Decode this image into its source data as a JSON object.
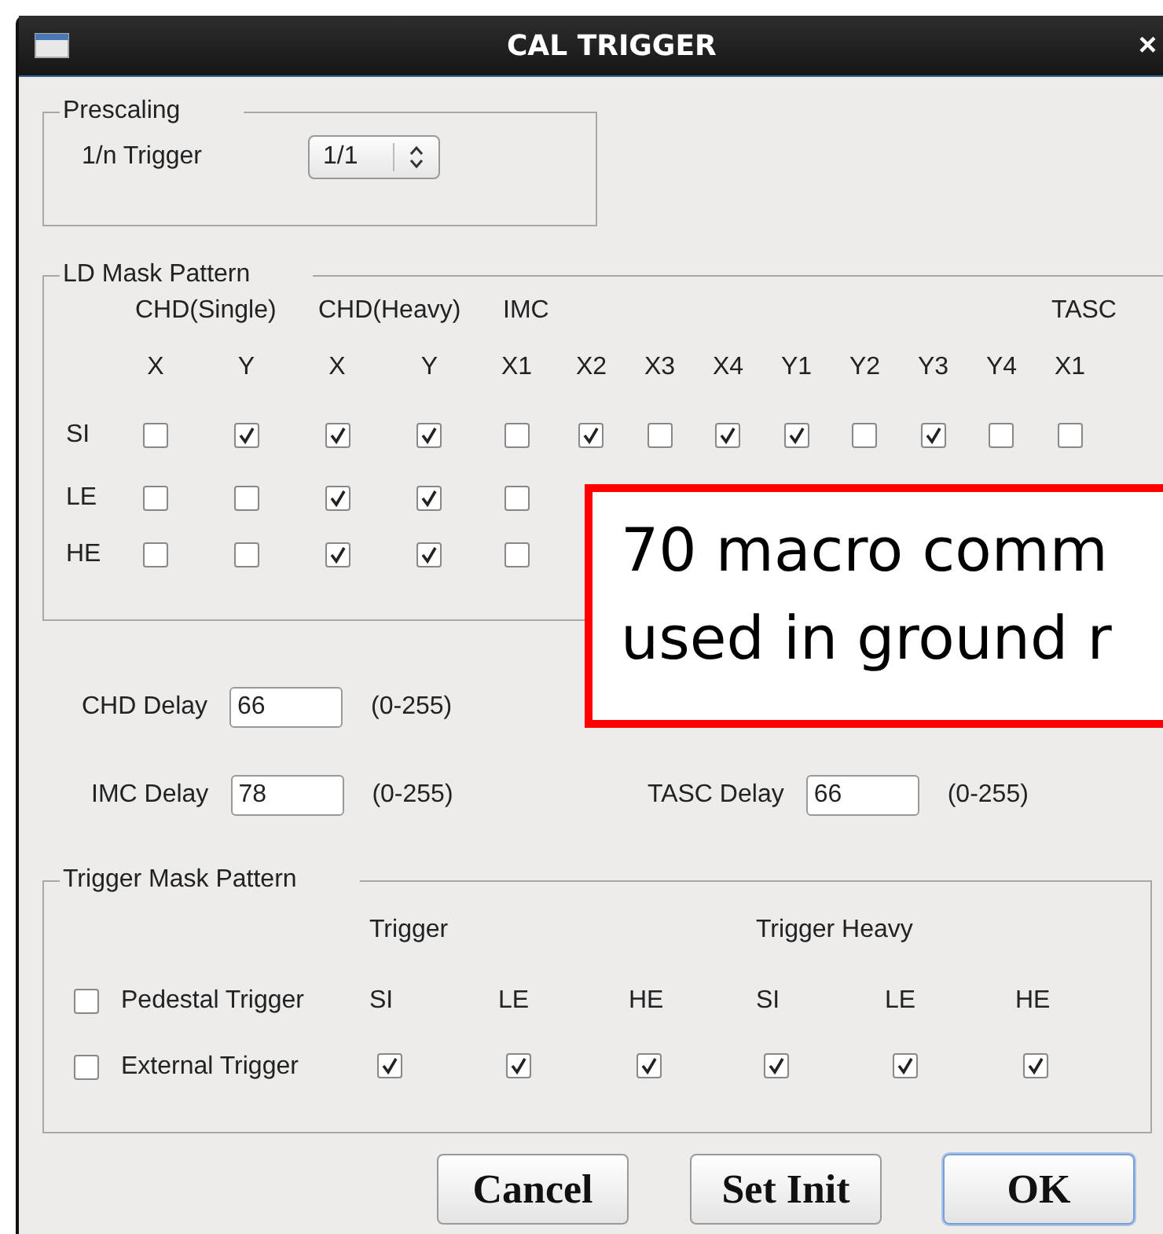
{
  "window": {
    "title": "CAL TRIGGER",
    "close": "×"
  },
  "prescaling": {
    "title": "Prescaling",
    "label": "1/n Trigger",
    "value": "1/1"
  },
  "ld_mask": {
    "title": "LD Mask Pattern",
    "groups": [
      {
        "label": "CHD(Single)",
        "columns": [
          "X",
          "Y"
        ]
      },
      {
        "label": "CHD(Heavy)",
        "columns": [
          "X",
          "Y"
        ]
      },
      {
        "label": "IMC",
        "columns": [
          "X1",
          "X2",
          "X3",
          "X4",
          "Y1",
          "Y2",
          "Y3",
          "Y4"
        ]
      },
      {
        "label": "TASC",
        "columns": [
          "X1"
        ]
      }
    ],
    "rows": [
      {
        "label": "SI",
        "checks": [
          false,
          true,
          true,
          true,
          false,
          true,
          false,
          true,
          true,
          false,
          true,
          false,
          false
        ]
      },
      {
        "label": "LE",
        "checks": [
          false,
          false,
          true,
          true,
          false
        ]
      },
      {
        "label": "HE",
        "checks": [
          false,
          false,
          true,
          true,
          false
        ]
      }
    ]
  },
  "delay_rows": [
    [
      {
        "label": "CHD Delay",
        "value": "66",
        "range": "(0-255)"
      }
    ],
    [
      {
        "label": "IMC Delay",
        "value": "78",
        "range": "(0-255)"
      },
      {
        "label": "TASC Delay",
        "value": "66",
        "range": "(0-255)"
      }
    ]
  ],
  "trigger_mask": {
    "title": "Trigger Mask Pattern",
    "groups": [
      {
        "label": "Trigger",
        "columns": [
          "SI",
          "LE",
          "HE"
        ]
      },
      {
        "label": "Trigger Heavy",
        "columns": [
          "SI",
          "LE",
          "HE"
        ]
      }
    ],
    "rows": [
      {
        "kind": "labels",
        "label": "Pedestal Trigger",
        "checked": false
      },
      {
        "kind": "checks",
        "label": "External Trigger",
        "checked": false,
        "checks": [
          true,
          true,
          true,
          true,
          true,
          true
        ]
      }
    ]
  },
  "buttons": [
    {
      "label": "Cancel",
      "focused": false
    },
    {
      "label": "Set Init",
      "focused": false
    },
    {
      "label": "OK",
      "focused": true
    }
  ],
  "callout": {
    "lines": [
      "70 macro comm",
      "used in ground r"
    ]
  }
}
